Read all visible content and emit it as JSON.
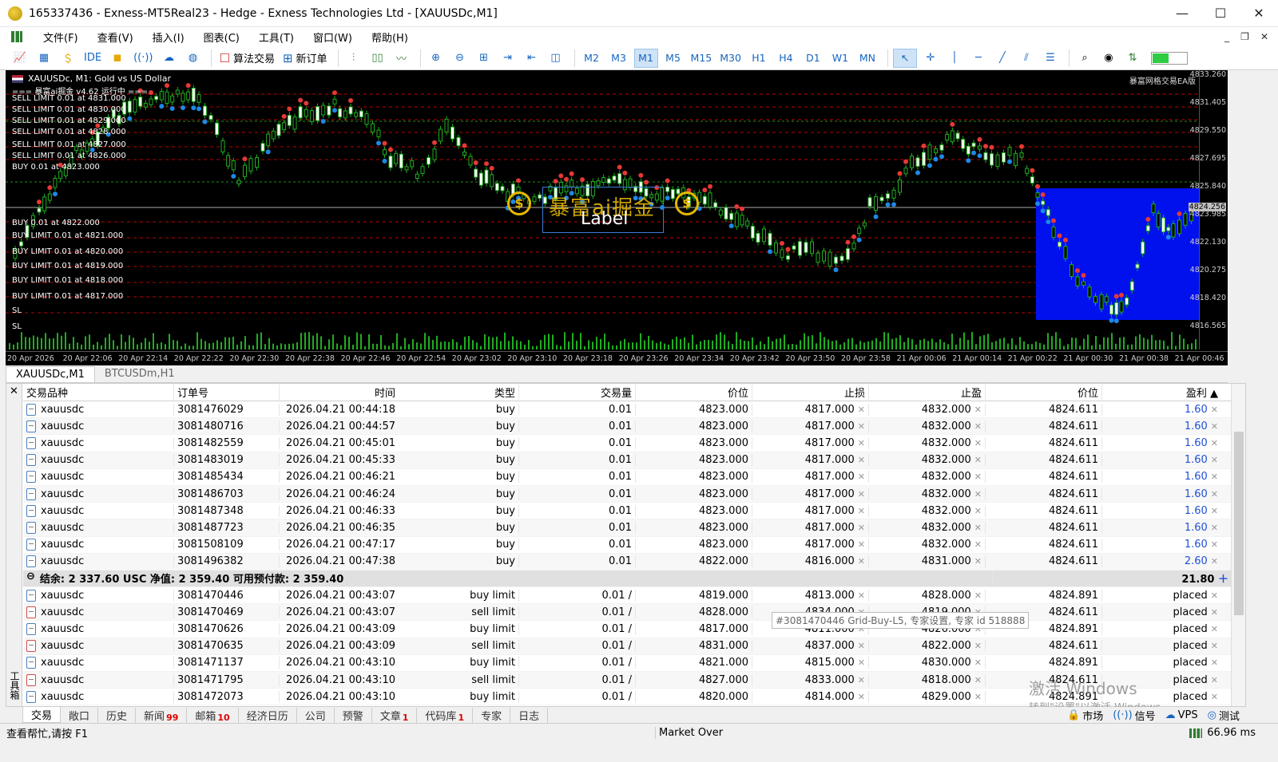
{
  "window": {
    "title": "165337436 - Exness-MT5Real23 - Hedge - Exness Technologies Ltd - [XAUUSDc,M1]",
    "minimize": "—",
    "maximize": "☐",
    "close": "✕"
  },
  "menu": {
    "items": [
      "文件(F)",
      "查看(V)",
      "插入(I)",
      "图表(C)",
      "工具(T)",
      "窗口(W)",
      "帮助(H)"
    ],
    "right": [
      "_",
      "❐",
      "✕"
    ]
  },
  "toolbar": {
    "ide": "IDE",
    "algo_trading": "算法交易",
    "new_order": "新订单",
    "timeframes": [
      "M2",
      "M3",
      "M1",
      "M5",
      "M15",
      "M30",
      "H1",
      "H4",
      "D1",
      "W1",
      "MN"
    ],
    "active_timeframe": "M1"
  },
  "chart": {
    "symbol_header": "XAUUSDc, M1:  Gold vs US Dollar",
    "note_right": "暴富网格交易EA版",
    "watermark_text": "暴富ai掘金",
    "label_text": "Label",
    "current_price": "4824.256",
    "price_ticks": [
      "4833.260",
      "4831.405",
      "4829.550",
      "4827.695",
      "4825.840",
      "4823.985",
      "4822.130",
      "4820.275",
      "4818.420",
      "4816.565"
    ],
    "time_ticks": [
      "20 Apr 2026",
      "20 Apr 22:06",
      "20 Apr 22:14",
      "20 Apr 22:22",
      "20 Apr 22:30",
      "20 Apr 22:38",
      "20 Apr 22:46",
      "20 Apr 22:54",
      "20 Apr 23:02",
      "20 Apr 23:10",
      "20 Apr 23:18",
      "20 Apr 23:26",
      "20 Apr 23:34",
      "20 Apr 23:42",
      "20 Apr 23:50",
      "20 Apr 23:58",
      "21 Apr 00:06",
      "21 Apr 00:14",
      "21 Apr 00:22",
      "21 Apr 00:30",
      "21 Apr 00:38",
      "21 Apr 00:46"
    ],
    "order_labels": [
      "=== 暴富ai掘金 v4.62 运行中 ===",
      "SELL LIMIT 0.01 at 4831.000",
      "SELL LIMIT 0.01 at 4830.000",
      "SELL LIMIT 0.01 at 4829.000",
      "SELL LIMIT 0.01 at 4828.000",
      "SELL LIMIT 0.01 at 4827.000",
      "SELL LIMIT 0.01 at 4826.000",
      "BUY 0.01 at 4823.000",
      "BUY 0.01 at 4822.000",
      "BUY LIMIT 0.01 at 4821.000",
      "BUY LIMIT 0.01 at 4820.000",
      "BUY LIMIT 0.01 at 4819.000",
      "BUY LIMIT 0.01 at 4818.000",
      "BUY LIMIT 0.01 at 4817.000",
      "SL",
      "SL"
    ]
  },
  "chart_tabs": [
    "XAUUSDc,M1",
    "BTCUSDm,H1"
  ],
  "table": {
    "headers": [
      "交易品种",
      "订单号",
      "时间",
      "类型",
      "交易量",
      "价位",
      "止损",
      "止盈",
      "价位",
      "盈利"
    ],
    "positions": [
      {
        "symbol": "xauusdc",
        "order": "3081476029",
        "time": "2026.04.21 00:44:18",
        "type": "buy",
        "volume": "0.01",
        "price": "4823.000",
        "sl": "4817.000",
        "tp": "4832.000",
        "current": "4824.611",
        "profit": "1.60"
      },
      {
        "symbol": "xauusdc",
        "order": "3081480716",
        "time": "2026.04.21 00:44:57",
        "type": "buy",
        "volume": "0.01",
        "price": "4823.000",
        "sl": "4817.000",
        "tp": "4832.000",
        "current": "4824.611",
        "profit": "1.60"
      },
      {
        "symbol": "xauusdc",
        "order": "3081482559",
        "time": "2026.04.21 00:45:01",
        "type": "buy",
        "volume": "0.01",
        "price": "4823.000",
        "sl": "4817.000",
        "tp": "4832.000",
        "current": "4824.611",
        "profit": "1.60"
      },
      {
        "symbol": "xauusdc",
        "order": "3081483019",
        "time": "2026.04.21 00:45:33",
        "type": "buy",
        "volume": "0.01",
        "price": "4823.000",
        "sl": "4817.000",
        "tp": "4832.000",
        "current": "4824.611",
        "profit": "1.60"
      },
      {
        "symbol": "xauusdc",
        "order": "3081485434",
        "time": "2026.04.21 00:46:21",
        "type": "buy",
        "volume": "0.01",
        "price": "4823.000",
        "sl": "4817.000",
        "tp": "4832.000",
        "current": "4824.611",
        "profit": "1.60"
      },
      {
        "symbol": "xauusdc",
        "order": "3081486703",
        "time": "2026.04.21 00:46:24",
        "type": "buy",
        "volume": "0.01",
        "price": "4823.000",
        "sl": "4817.000",
        "tp": "4832.000",
        "current": "4824.611",
        "profit": "1.60"
      },
      {
        "symbol": "xauusdc",
        "order": "3081487348",
        "time": "2026.04.21 00:46:33",
        "type": "buy",
        "volume": "0.01",
        "price": "4823.000",
        "sl": "4817.000",
        "tp": "4832.000",
        "current": "4824.611",
        "profit": "1.60"
      },
      {
        "symbol": "xauusdc",
        "order": "3081487723",
        "time": "2026.04.21 00:46:35",
        "type": "buy",
        "volume": "0.01",
        "price": "4823.000",
        "sl": "4817.000",
        "tp": "4832.000",
        "current": "4824.611",
        "profit": "1.60"
      },
      {
        "symbol": "xauusdc",
        "order": "3081508109",
        "time": "2026.04.21 00:47:17",
        "type": "buy",
        "volume": "0.01",
        "price": "4823.000",
        "sl": "4817.000",
        "tp": "4832.000",
        "current": "4824.611",
        "profit": "1.60"
      },
      {
        "symbol": "xauusdc",
        "order": "3081496382",
        "time": "2026.04.21 00:47:38",
        "type": "buy",
        "volume": "0.01",
        "price": "4822.000",
        "sl": "4816.000",
        "tp": "4831.000",
        "current": "4824.611",
        "profit": "2.60"
      }
    ],
    "summary": {
      "text": "结余: 2 337.60 USC  净值: 2 359.40  可用预付款: 2 359.40",
      "total": "21.80"
    },
    "orders": [
      {
        "symbol": "xauusdc",
        "order": "3081470446",
        "time": "2026.04.21 00:43:07",
        "type": "buy limit",
        "volume": "0.01 /",
        "price": "4819.000",
        "sl": "4813.000",
        "tp": "4828.000",
        "current": "4824.891",
        "status": "placed",
        "side": "buy"
      },
      {
        "symbol": "xauusdc",
        "order": "3081470469",
        "time": "2026.04.21 00:43:07",
        "type": "sell limit",
        "volume": "0.01 /",
        "price": "4828.000",
        "sl": "4834.000",
        "tp": "4819.000",
        "current": "4824.611",
        "status": "placed",
        "side": "sell"
      },
      {
        "symbol": "xauusdc",
        "order": "3081470626",
        "time": "2026.04.21 00:43:09",
        "type": "buy limit",
        "volume": "0.01 /",
        "price": "4817.000",
        "sl": "4811.000",
        "tp": "4826.000",
        "current": "4824.891",
        "status": "placed",
        "side": "buy"
      },
      {
        "symbol": "xauusdc",
        "order": "3081470635",
        "time": "2026.04.21 00:43:09",
        "type": "sell limit",
        "volume": "0.01 /",
        "price": "4831.000",
        "sl": "4837.000",
        "tp": "4822.000",
        "current": "4824.611",
        "status": "placed",
        "side": "sell"
      },
      {
        "symbol": "xauusdc",
        "order": "3081471137",
        "time": "2026.04.21 00:43:10",
        "type": "buy limit",
        "volume": "0.01 /",
        "price": "4821.000",
        "sl": "4815.000",
        "tp": "4830.000",
        "current": "4824.891",
        "status": "placed",
        "side": "buy"
      },
      {
        "symbol": "xauusdc",
        "order": "3081471795",
        "time": "2026.04.21 00:43:10",
        "type": "sell limit",
        "volume": "0.01 /",
        "price": "4827.000",
        "sl": "4833.000",
        "tp": "4818.000",
        "current": "4824.611",
        "status": "placed",
        "side": "sell"
      },
      {
        "symbol": "xauusdc",
        "order": "3081472073",
        "time": "2026.04.21 00:43:10",
        "type": "buy limit",
        "volume": "0.01 /",
        "price": "4820.000",
        "sl": "4814.000",
        "tp": "4829.000",
        "current": "4824.891",
        "status": "placed",
        "side": "buy"
      }
    ],
    "tooltip": "#3081470446 Grid-Buy-L5, 专家设置, 专家 id 518888"
  },
  "toolbox_label": "工具箱",
  "activation": {
    "line1": "激活 Windows",
    "line2": "转到\"设置\"以激活 Windows。"
  },
  "bottom_tabs": [
    {
      "label": "交易",
      "badge": ""
    },
    {
      "label": "敞口",
      "badge": ""
    },
    {
      "label": "历史",
      "badge": ""
    },
    {
      "label": "新闻",
      "badge": "99"
    },
    {
      "label": "邮箱",
      "badge": "10"
    },
    {
      "label": "经济日历",
      "badge": ""
    },
    {
      "label": "公司",
      "badge": ""
    },
    {
      "label": "预警",
      "badge": ""
    },
    {
      "label": "文章",
      "badge": "1"
    },
    {
      "label": "代码库",
      "badge": "1"
    },
    {
      "label": "专家",
      "badge": ""
    },
    {
      "label": "日志",
      "badge": ""
    }
  ],
  "bottom_right": [
    "市场",
    "信号",
    "VPS",
    "测试"
  ],
  "status": {
    "help": "查看帮忙,请按 F1",
    "market": "Market Over",
    "ping": "66.96 ms"
  }
}
